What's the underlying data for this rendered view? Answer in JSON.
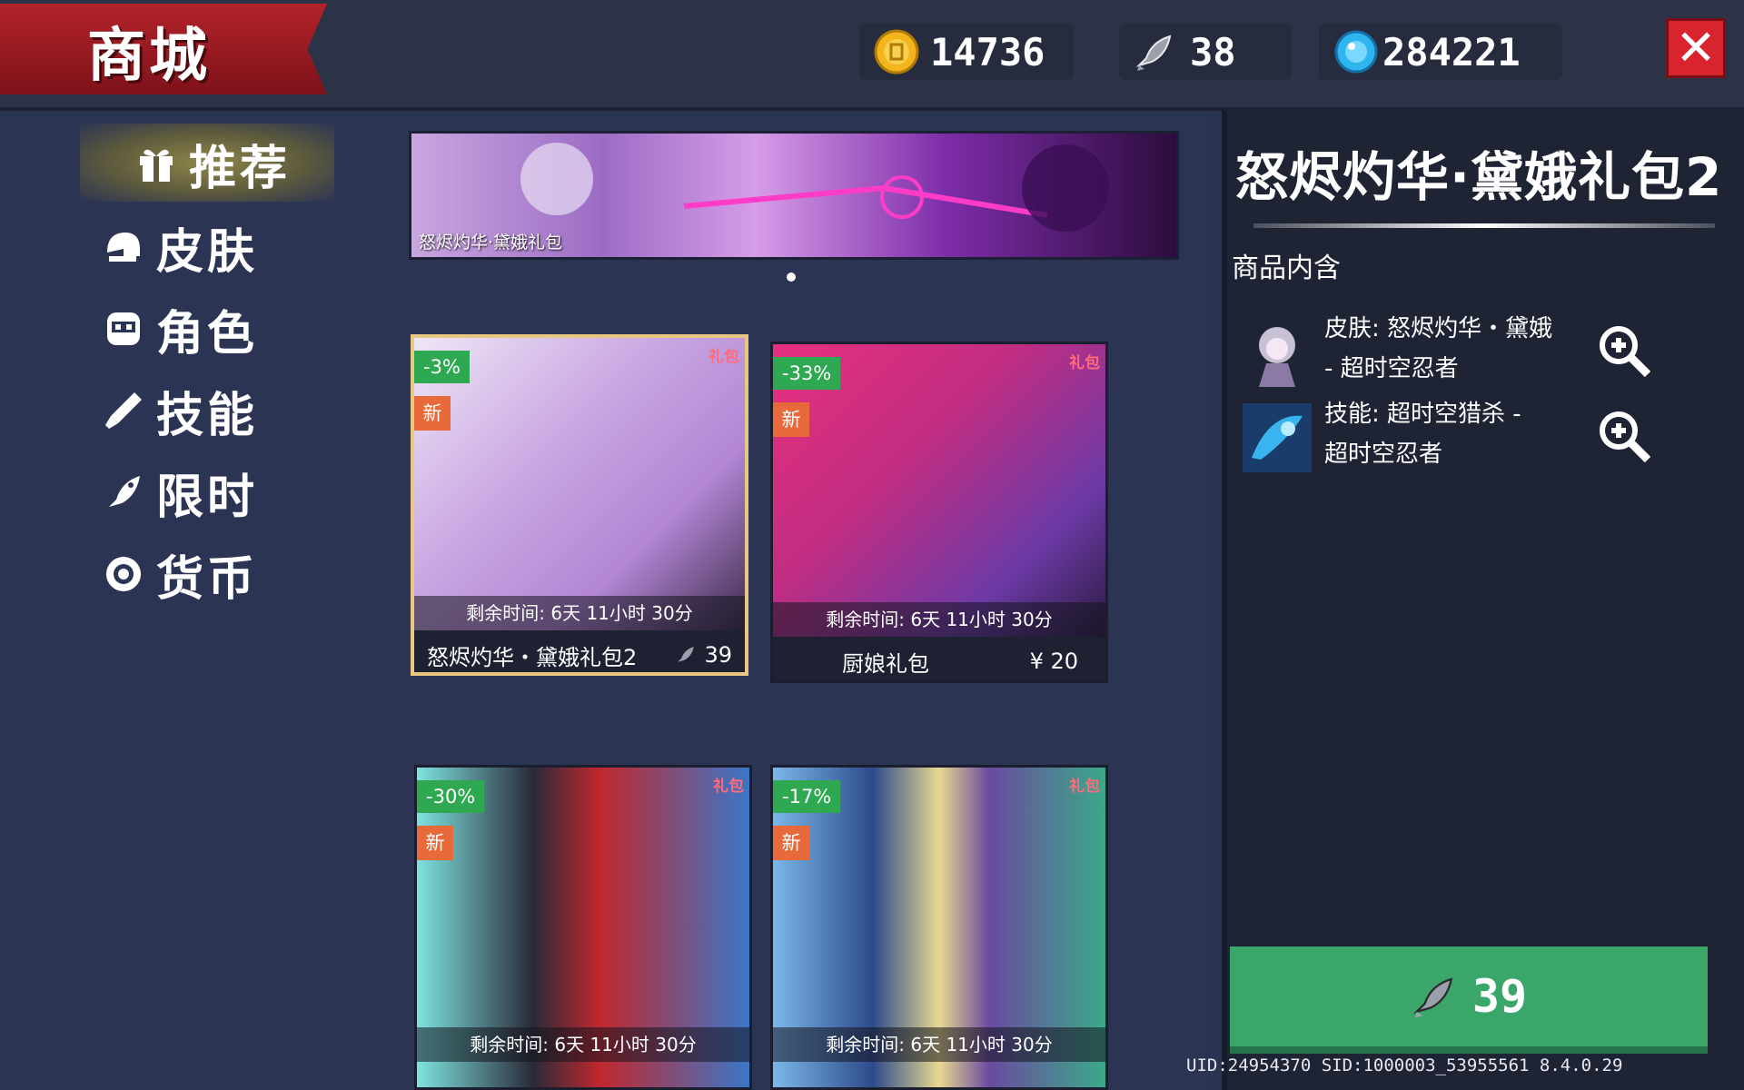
{
  "header": {
    "title": "商城",
    "coins": "14736",
    "fish": "38",
    "gems": "284221",
    "close_icon": "close-icon"
  },
  "sidebar": {
    "items": [
      {
        "label": "推荐",
        "icon": "gift-icon",
        "active": true
      },
      {
        "label": "皮肤",
        "icon": "helmet-icon",
        "active": false
      },
      {
        "label": "角色",
        "icon": "character-icon",
        "active": false
      },
      {
        "label": "技能",
        "icon": "skill-icon",
        "active": false
      },
      {
        "label": "限时",
        "icon": "limited-icon",
        "active": false
      },
      {
        "label": "货币",
        "icon": "currency-icon",
        "active": false
      }
    ]
  },
  "banner": {
    "caption": "怒烬灼华·黛娥礼包"
  },
  "cards": [
    {
      "discount": "-3%",
      "new": "新",
      "gift": "礼包",
      "timer": "剩余时间: 6天 11小时 30分",
      "name": "怒烬灼华・黛娥礼包2",
      "price": "39",
      "price_icon": "fish-icon"
    },
    {
      "discount": "-33%",
      "new": "新",
      "gift": "礼包",
      "timer": "剩余时间: 6天 11小时 30分",
      "name": "厨娘礼包",
      "price": "¥ 20"
    },
    {
      "discount": "-30%",
      "new": "新",
      "gift": "礼包",
      "timer": "剩余时间: 6天 11小时 30分"
    },
    {
      "discount": "-17%",
      "new": "新",
      "gift": "礼包",
      "timer": "剩余时间: 6天 11小时 30分"
    }
  ],
  "detail": {
    "title": "怒烬灼华·黛娥礼包2",
    "contents_label": "商品内含",
    "items": [
      {
        "line1": "皮肤: 怒烬灼华・黛娥",
        "line2": "- 超时空忍者"
      },
      {
        "line1": "技能: 超时空猎杀 -",
        "line2": "超时空忍者"
      }
    ],
    "buy_price": "39"
  },
  "footer": {
    "uid": "UID:24954370 SID:1000003_53955561 8.4.0.29"
  },
  "colors": {
    "buy_button": "#3aa66a",
    "title_banner": "#b3232b",
    "discount_badge": "#2fa852",
    "new_badge": "#e86a3a"
  }
}
